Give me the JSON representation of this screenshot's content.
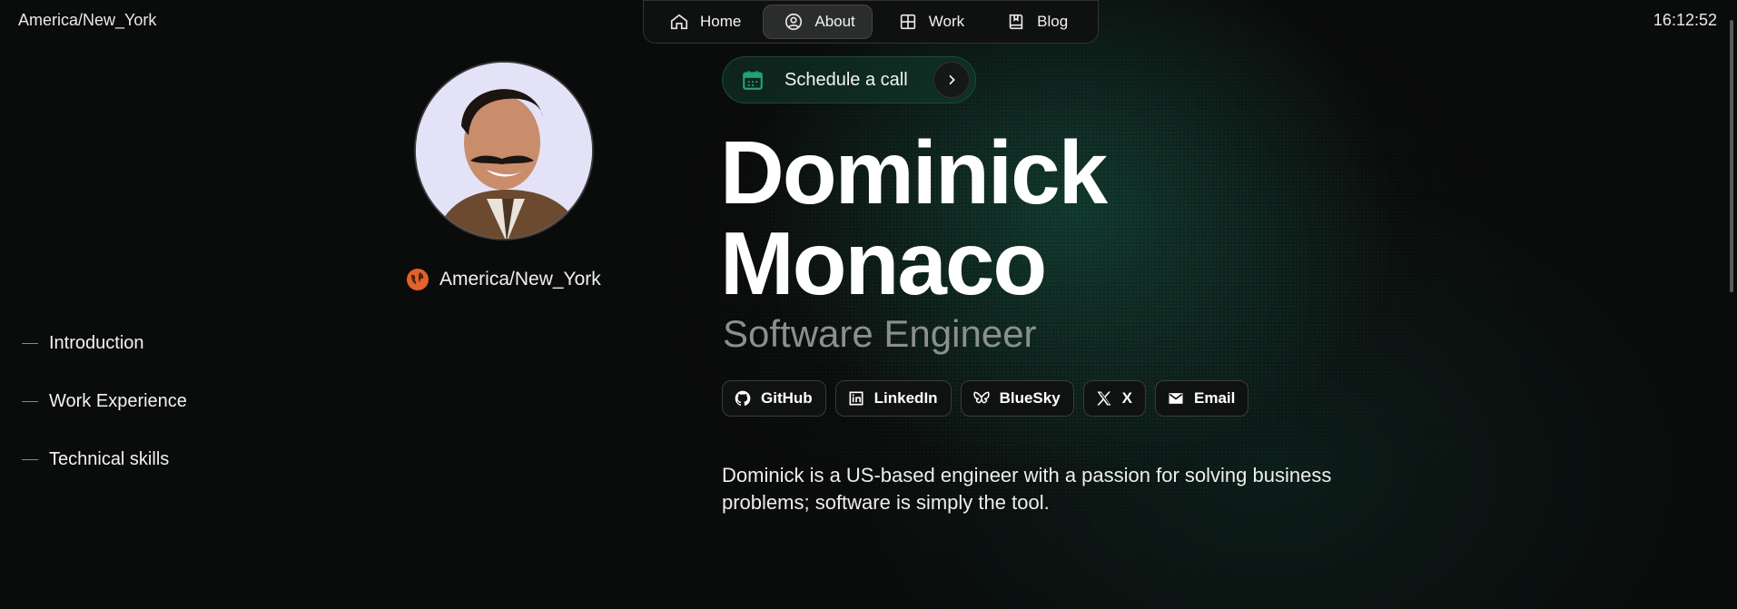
{
  "header": {
    "timezone": "America/New_York",
    "time": "16:12:52"
  },
  "nav": {
    "items": [
      {
        "label": "Home",
        "icon": "home-icon",
        "active": false
      },
      {
        "label": "About",
        "icon": "user-circle-icon",
        "active": true
      },
      {
        "label": "Work",
        "icon": "grid-icon",
        "active": false
      },
      {
        "label": "Blog",
        "icon": "book-icon",
        "active": false
      }
    ]
  },
  "profile": {
    "location": "America/New_York"
  },
  "toc": {
    "items": [
      "Introduction",
      "Work Experience",
      "Technical skills"
    ]
  },
  "cta": {
    "label": "Schedule a call"
  },
  "hero": {
    "first_name": "Dominick",
    "last_name": "Monaco",
    "role": "Software Engineer"
  },
  "socials": [
    {
      "label": "GitHub",
      "icon": "github-icon"
    },
    {
      "label": "LinkedIn",
      "icon": "linkedin-icon"
    },
    {
      "label": "BlueSky",
      "icon": "bluesky-icon"
    },
    {
      "label": "X",
      "icon": "x-icon"
    },
    {
      "label": "Email",
      "icon": "email-icon"
    }
  ],
  "intro": {
    "text": "Dominick is a US-based engineer with a passion for solving business problems; software is simply the tool."
  },
  "colors": {
    "background": "#0a0b0b",
    "accent": "#1a7a5e",
    "globe": "#e2622a",
    "muted": "#8b8f8d"
  }
}
